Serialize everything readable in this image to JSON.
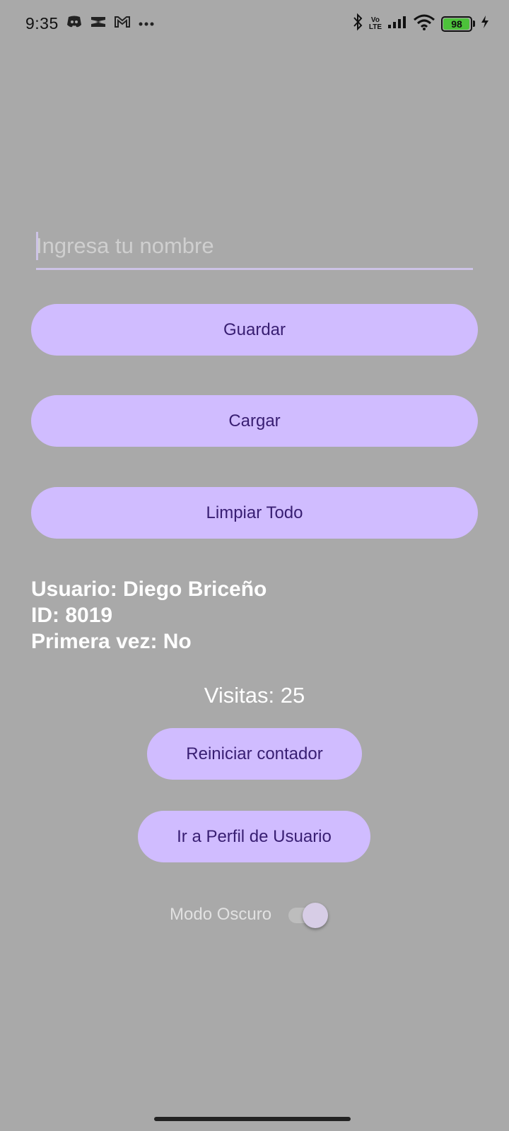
{
  "status_bar": {
    "time": "9:35",
    "battery_level": "98",
    "battery_fraction": 0.98,
    "network_label": "LTE",
    "left_icons": [
      "discord-icon",
      "capcut-icon",
      "gmail-icon",
      "more-dots-icon"
    ],
    "right_icons": [
      "bluetooth-icon",
      "volte-icon",
      "signal-icon",
      "wifi-icon",
      "battery-icon",
      "charging-icon"
    ]
  },
  "form": {
    "name_placeholder": "Ingresa tu nombre",
    "name_value": "",
    "save_label": "Guardar",
    "load_label": "Cargar",
    "clear_label": "Limpiar Todo"
  },
  "user": {
    "name_line": "Usuario: Diego Briceño",
    "id_line": "ID: 8019",
    "first_time_line": "Primera vez: No"
  },
  "counter": {
    "visits_text": "Visitas: 25",
    "reset_label": "Reiniciar contador",
    "profile_label": "Ir a Perfil de Usuario"
  },
  "settings": {
    "dark_mode_label": "Modo Oscuro",
    "dark_mode_on": true
  },
  "colors": {
    "background": "#a9a9a9",
    "button_bg": "#d0bcff",
    "button_text": "#381e72",
    "battery_green": "#4cc23a"
  }
}
